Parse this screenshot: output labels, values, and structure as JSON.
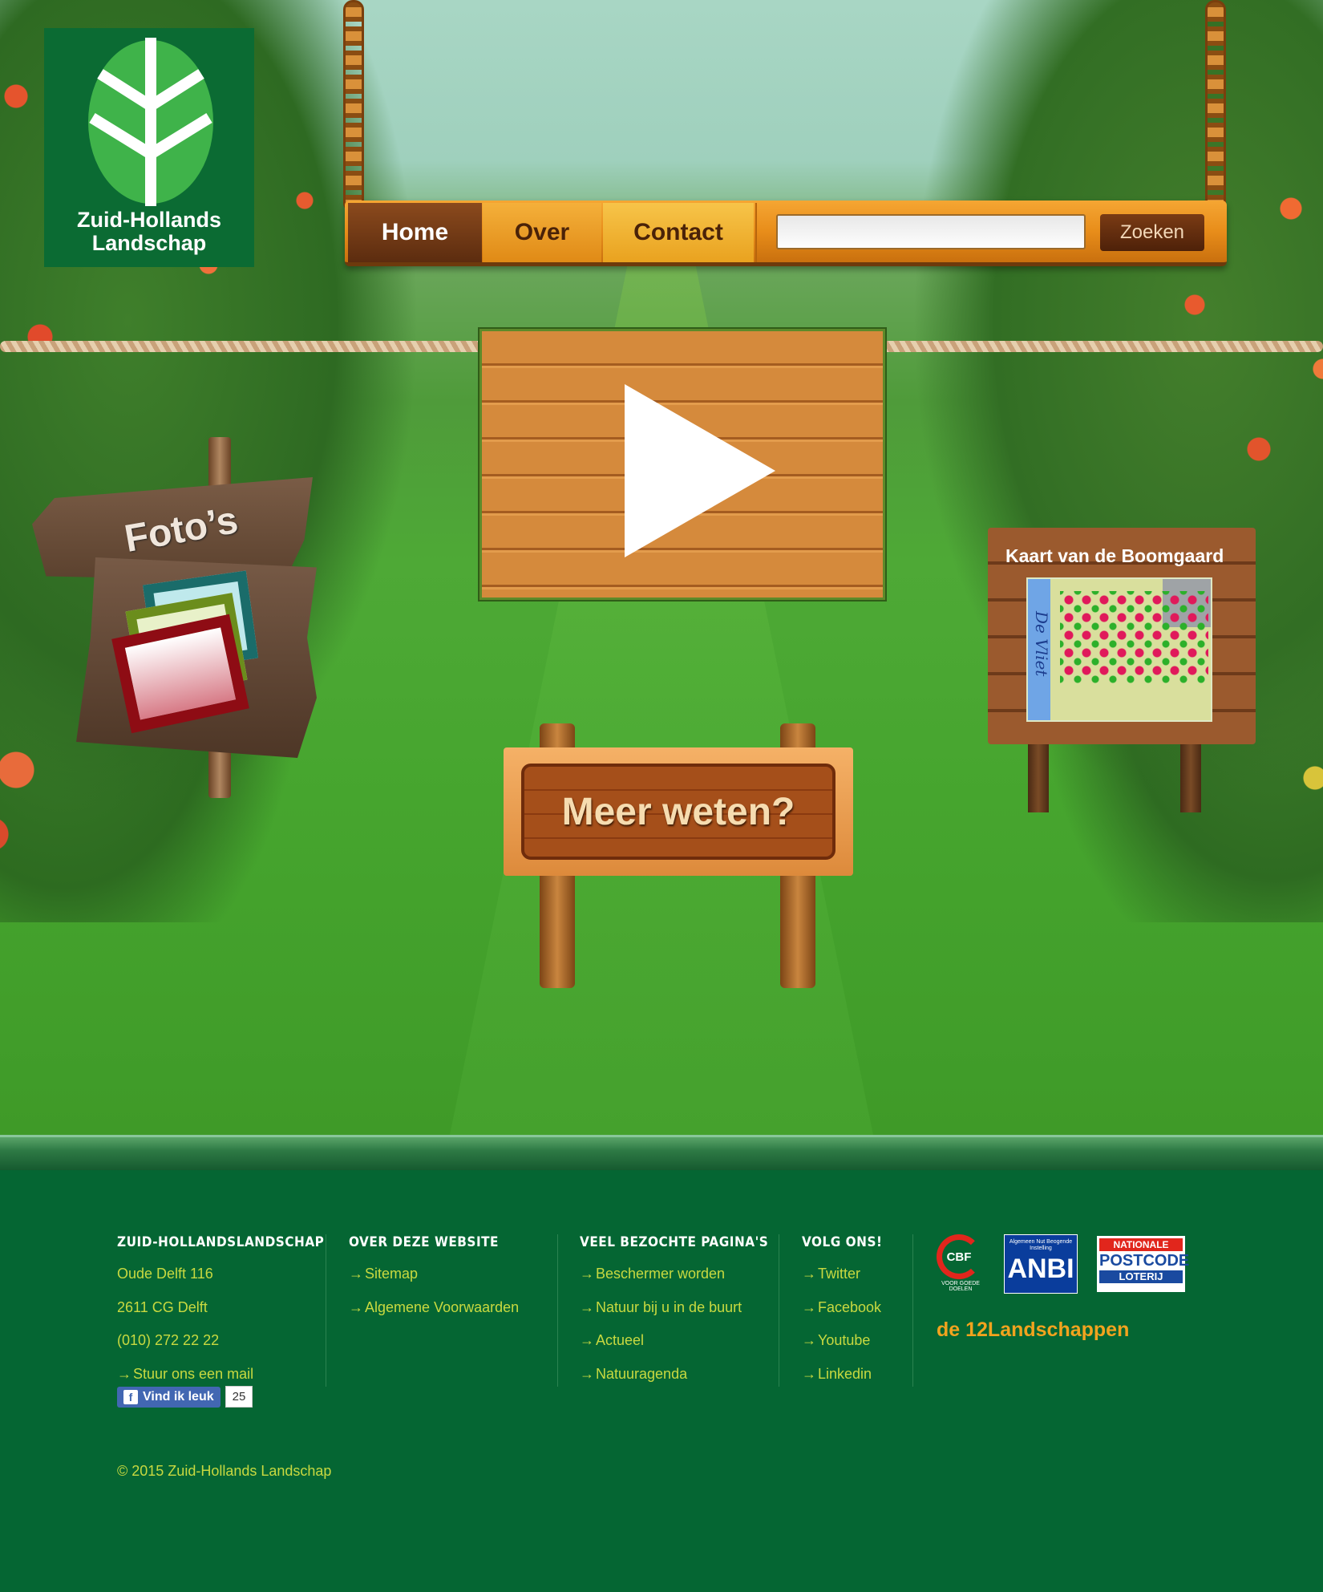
{
  "logo": {
    "line1": "Zuid-Hollands",
    "line2": "Landschap"
  },
  "nav": {
    "items": [
      {
        "label": "Home",
        "active": true
      },
      {
        "label": "Over",
        "active": false
      },
      {
        "label": "Contact",
        "active": false
      }
    ],
    "search": {
      "value": "",
      "placeholder": "",
      "button": "Zoeken"
    }
  },
  "video": {
    "icon": "play-icon"
  },
  "signs": {
    "fotos": "Foto’s",
    "kaart_title": "Kaart van de  Boomgaard",
    "kaart_map_label": "De Vliet",
    "meer": "Meer weten?"
  },
  "footer": {
    "col1": {
      "heading": "ZUID-HOLLANDSLANDSCHAP",
      "lines": [
        "Oude Delft 116",
        "2611 CG Delft",
        "(010) 272 22 22"
      ],
      "mail_link": "Stuur ons een mail",
      "facebook": {
        "label": "Vind ik leuk",
        "count": "25"
      }
    },
    "col2": {
      "heading": "OVER DEZE WEBSITE",
      "links": [
        "Sitemap",
        "Algemene Voorwaarden"
      ]
    },
    "col3": {
      "heading": "VEEL BEZOCHTE PAGINA'S",
      "links": [
        "Beschermer worden",
        "Natuur bij u in de buurt",
        "Actueel",
        "Natuuragenda"
      ]
    },
    "col4": {
      "heading": "VOLG ONS!",
      "links": [
        "Twitter",
        "Facebook",
        "Youtube",
        "Linkedin"
      ]
    },
    "badges": {
      "cbf": "CBF",
      "cbf_sub": "VOOR GOEDE DOELEN",
      "anbi_small": "Algemeen Nut Beogende Instelling",
      "anbi": "ANBI",
      "npl_top": "NATIONALE",
      "npl_mid": "POSTCODE",
      "npl_bottom": "LOTERIJ",
      "landschappen": "de 12Landschappen"
    },
    "copyright": "© 2015 Zuid-Hollands Landschap"
  },
  "colors": {
    "footer_bg": "#056633",
    "link": "#c8d940",
    "nav_orange": "#e88d1a",
    "nav_active": "#5c2c0f"
  }
}
